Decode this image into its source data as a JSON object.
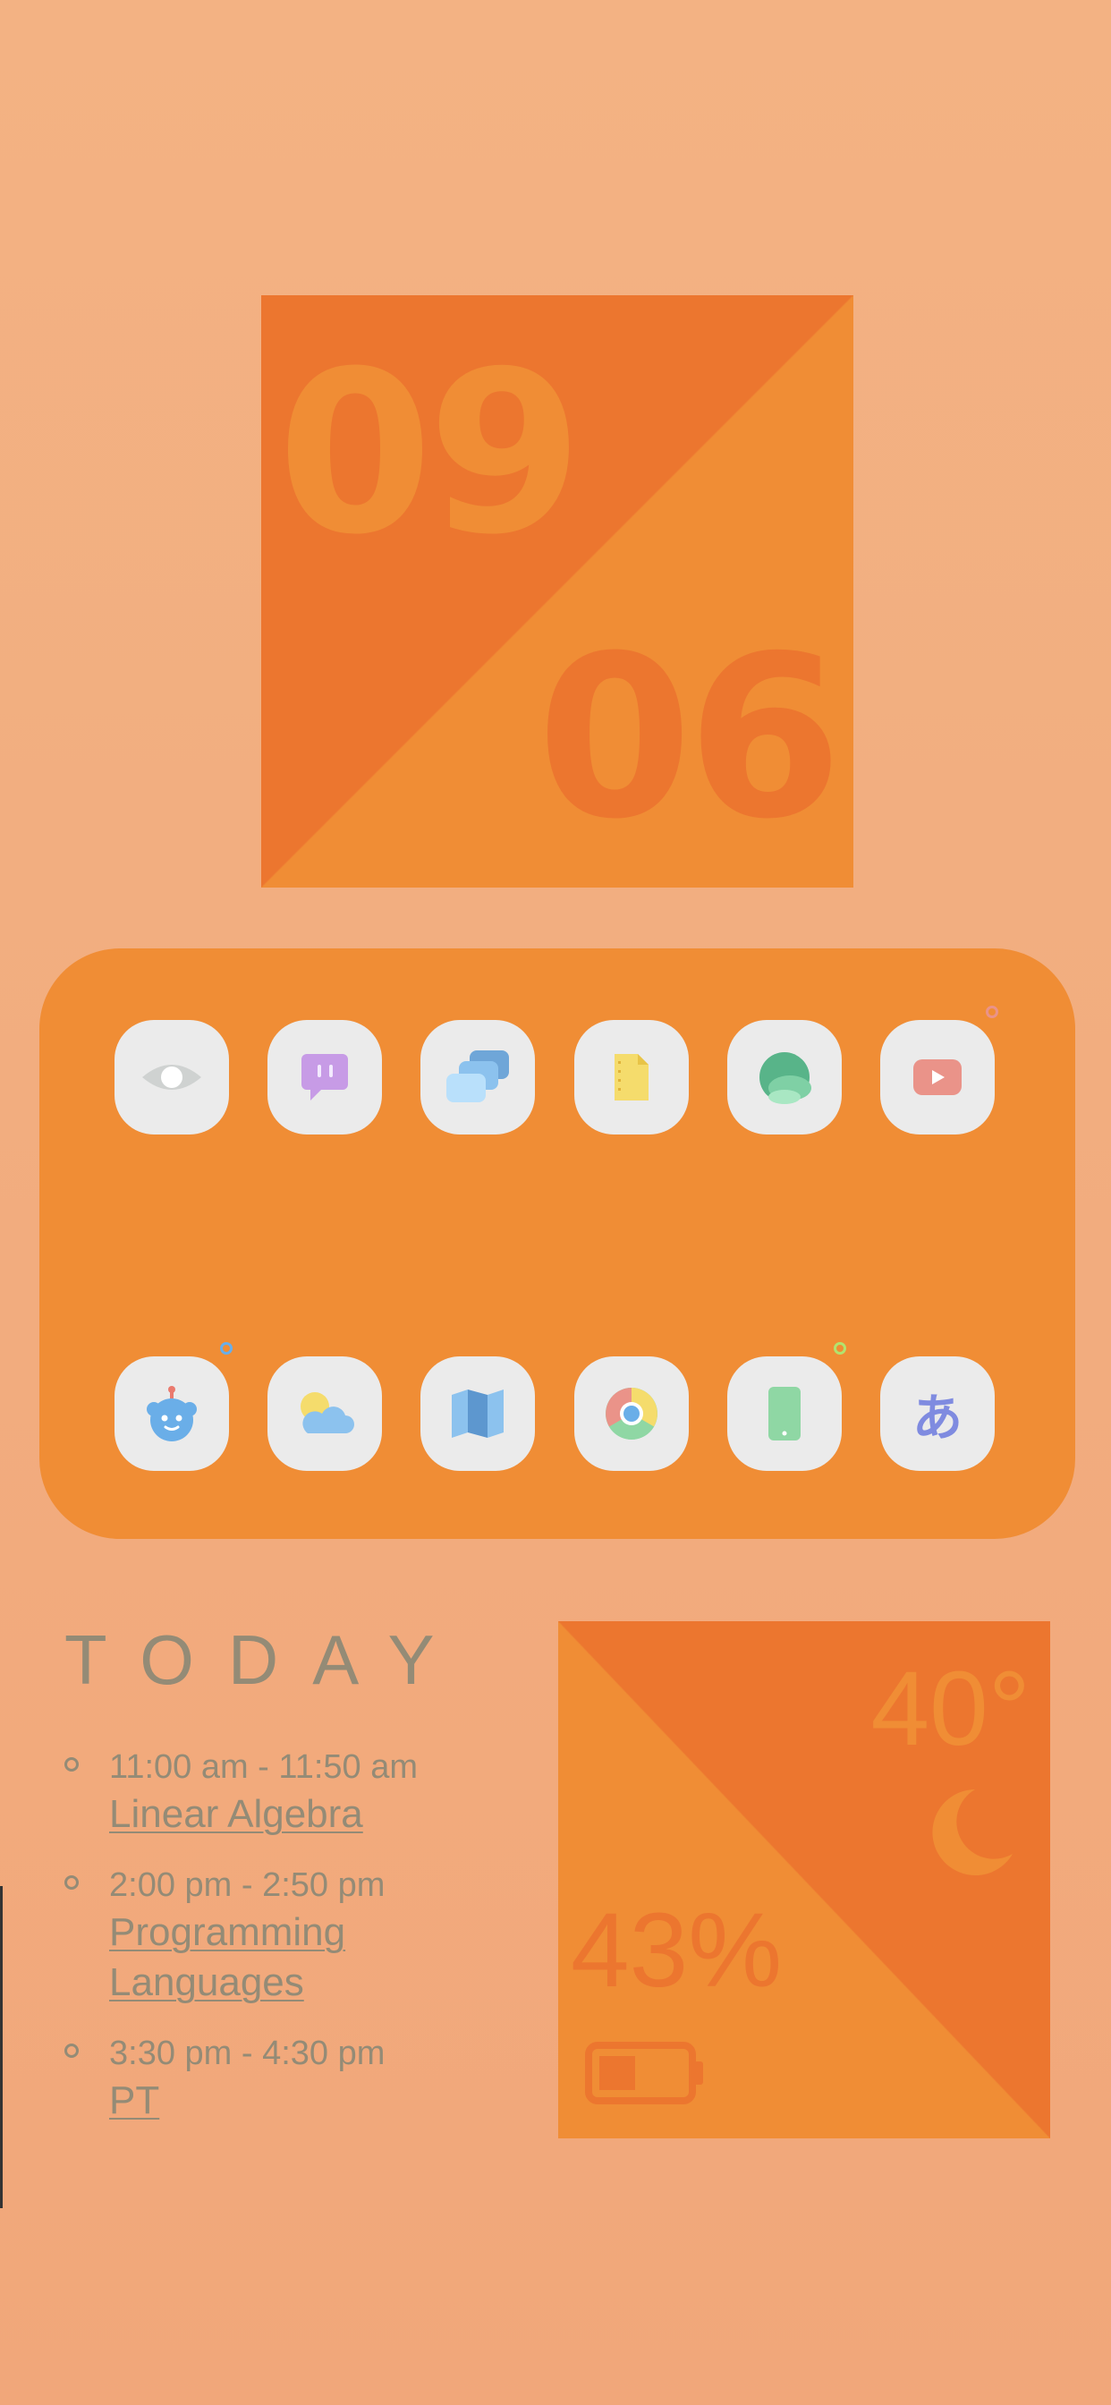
{
  "clock": {
    "hour": "09",
    "minute": "06"
  },
  "dock": {
    "apps": [
      {
        "name": "eye-app-icon",
        "indicator": false
      },
      {
        "name": "chat-app-icon",
        "indicator": false
      },
      {
        "name": "windows-app-icon",
        "indicator": false
      },
      {
        "name": "notes-app-icon",
        "indicator": false
      },
      {
        "name": "globe-app-icon",
        "indicator": false
      },
      {
        "name": "youtube-app-icon",
        "indicator": true
      },
      {
        "name": "bot-app-icon",
        "indicator": true
      },
      {
        "name": "weather-app-icon",
        "indicator": false
      },
      {
        "name": "maps-app-icon",
        "indicator": false
      },
      {
        "name": "chrome-app-icon",
        "indicator": false
      },
      {
        "name": "phone-app-icon",
        "indicator": true
      },
      {
        "name": "japanese-keyboard-app-icon",
        "indicator": false
      }
    ],
    "kana_glyph": "あ"
  },
  "today": {
    "heading": "TODAY",
    "events": [
      {
        "time": "11:00 am - 11:50 am",
        "title": "Linear Algebra"
      },
      {
        "time": "2:00 pm - 2:50 pm",
        "title": "Programming Languages"
      },
      {
        "time": "3:30 pm - 4:30 pm",
        "title": "PT"
      }
    ]
  },
  "weather": {
    "temperature": "40°",
    "condition_icon": "moon-icon"
  },
  "battery": {
    "percent_label": "43%",
    "level": 0.43,
    "icon": "battery-icon"
  },
  "colors": {
    "background": "#f3b283",
    "accent_dark": "#ec762f",
    "accent_light": "#f08d35",
    "text": "#948b76",
    "icon_tile": "#ebebeb"
  }
}
